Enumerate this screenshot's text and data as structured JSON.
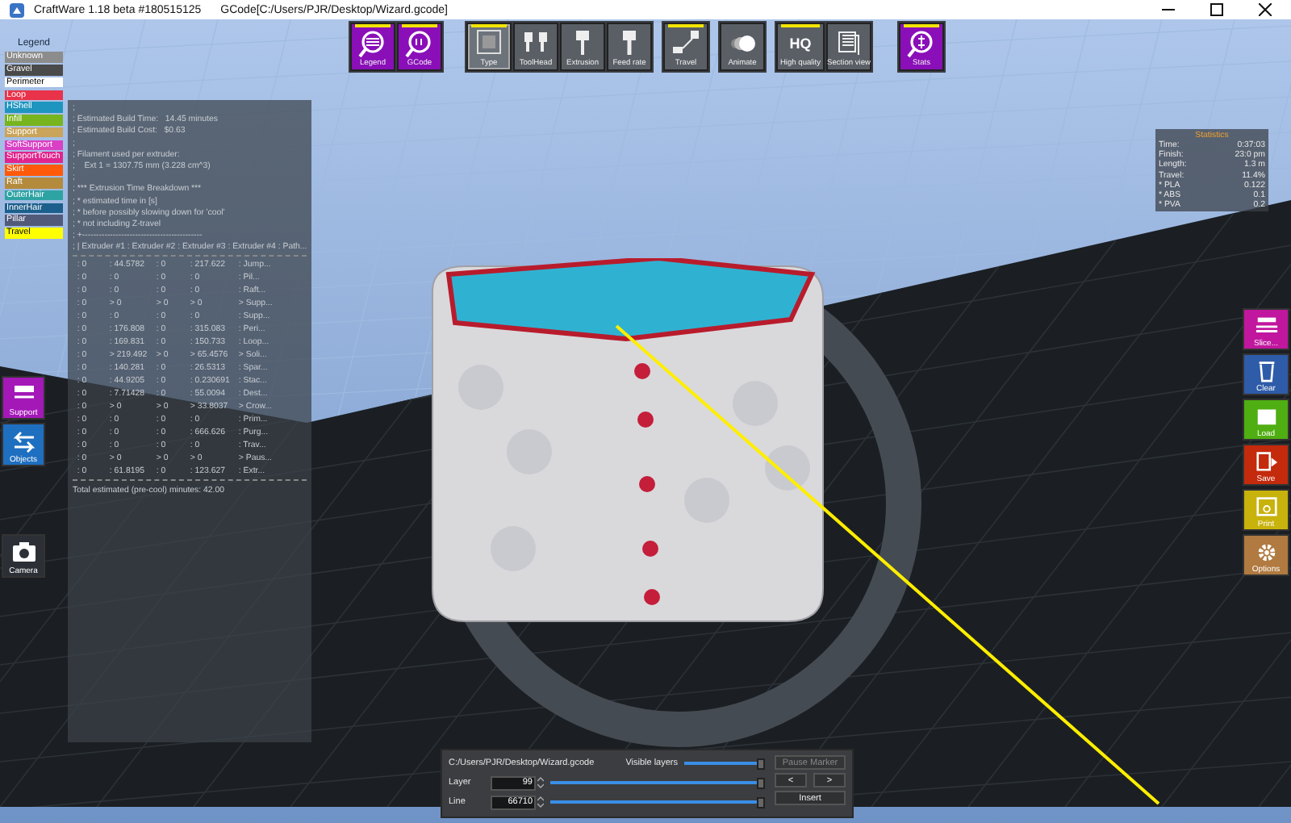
{
  "window": {
    "title": "CraftWare 1.18 beta #180515125",
    "document": "GCode[C:/Users/PJR/Desktop/Wizard.gcode]"
  },
  "legend": {
    "title": "Legend",
    "items": [
      {
        "label": "Unknown",
        "color": "#8c8c8c"
      },
      {
        "label": "Gravel",
        "color": "#4a4a4a"
      },
      {
        "label": "Perimeter",
        "color": "#ffffff"
      },
      {
        "label": "Loop",
        "color": "#e8334a"
      },
      {
        "label": "HShell",
        "color": "#1e95bf"
      },
      {
        "label": "Infill",
        "color": "#78b41e"
      },
      {
        "label": "Support",
        "color": "#c9a45a"
      },
      {
        "label": "SoftSupport",
        "color": "#d940c4"
      },
      {
        "label": "SupportTouch",
        "color": "#e0248e"
      },
      {
        "label": "Skirt",
        "color": "#ff5a0a"
      },
      {
        "label": "Raft",
        "color": "#b48a3c"
      },
      {
        "label": "OuterHair",
        "color": "#2ea3a3"
      },
      {
        "label": "InnerHair",
        "color": "#1d5f8c"
      },
      {
        "label": "Pillar",
        "color": "#525a7a"
      },
      {
        "label": "Travel",
        "color": "#ffff00"
      }
    ]
  },
  "toolbar": [
    [
      {
        "label": "Legend",
        "accent": true,
        "on": true,
        "selected": false
      },
      {
        "label": "GCode",
        "accent": true,
        "on": true,
        "selected": false
      }
    ],
    [
      {
        "label": "Type",
        "accent": false,
        "on": true,
        "selected": true
      },
      {
        "label": "ToolHead",
        "accent": false,
        "on": false,
        "selected": false
      },
      {
        "label": "Extrusion",
        "accent": false,
        "on": false,
        "selected": false
      },
      {
        "label": "Feed rate",
        "accent": false,
        "on": false,
        "selected": false
      }
    ],
    [
      {
        "label": "Travel",
        "accent": false,
        "on": true,
        "selected": false
      }
    ],
    [
      {
        "label": "Animate",
        "accent": false,
        "on": false,
        "selected": false
      }
    ],
    [
      {
        "label": "High quality",
        "badge": "HQ",
        "accent": false,
        "on": true,
        "selected": false
      },
      {
        "label": "Section view",
        "accent": false,
        "on": false,
        "selected": false
      }
    ],
    [
      {
        "label": "Stats",
        "accent": true,
        "on": true,
        "selected": false
      }
    ]
  ],
  "log": {
    "lines": [
      ";",
      "; Estimated Build Time:   14.45 minutes",
      "; Estimated Build Cost:   $0.63",
      ";",
      "; Filament used per extruder:",
      ";    Ext 1 = 1307.75 mm (3.228 cm^3)",
      ";",
      "; *** Extrusion Time Breakdown ***",
      "; * estimated time in [s]",
      "; * before possibly slowing down for 'cool'",
      "; * not including Z-travel",
      "; +-------------------------------------------",
      "; | Extruder #1 : Extruder #2 : Extruder #3 : Extruder #4 : Path..."
    ],
    "rows": [
      [
        "  : 0",
        "  : 44.5782",
        "  : 0",
        "  : 217.622",
        "  : Jump..."
      ],
      [
        "  : 0",
        "  : 0",
        "  : 0",
        "  : 0",
        "  : Pil..."
      ],
      [
        "  : 0",
        "  : 0",
        "  : 0",
        "  : 0",
        "  : Raft..."
      ],
      [
        "  : 0",
        "  > 0",
        "  > 0",
        "  > 0",
        "  > Supp..."
      ],
      [
        "  : 0",
        "  : 0",
        "  : 0",
        "  : 0",
        "  : Supp..."
      ],
      [
        "  : 0",
        "  : 176.808",
        "  : 0",
        "  : 315.083",
        "  : Peri..."
      ],
      [
        "  : 0",
        "  : 169.831",
        "  : 0",
        "  : 150.733",
        "  : Loop..."
      ],
      [
        "  : 0",
        "  > 219.492",
        "  > 0",
        "  > 65.4576",
        "  > Soli..."
      ],
      [
        "  : 0",
        "  : 140.281",
        "  : 0",
        "  : 26.5313",
        "  : Spar..."
      ],
      [
        "  : 0",
        "  : 44.9205",
        "  : 0",
        "  : 0.230691",
        "  : Stac..."
      ],
      [
        "  : 0",
        "  : 7.71428",
        "  : 0",
        "  : 55.0094",
        "  : Dest..."
      ],
      [
        "  : 0",
        "  > 0",
        "  > 0",
        "  > 33.8037",
        "  > Crow..."
      ],
      [
        "  : 0",
        "  : 0",
        "  : 0",
        "  : 0",
        "  : Prim..."
      ],
      [
        "  : 0",
        "  : 0",
        "  : 0",
        "  : 666.626",
        "  : Purg..."
      ],
      [
        "  : 0",
        "  : 0",
        "  : 0",
        "  : 0",
        "  : Trav..."
      ],
      [
        "  : 0",
        "  > 0",
        "  > 0",
        "  > 0",
        "  > Paus..."
      ],
      [
        "  : 0",
        "  : 61.8195",
        "  : 0",
        "  : 123.627",
        "  : Extr..."
      ]
    ],
    "total": "Total estimated (pre-cool) minutes: 42.00"
  },
  "stats": {
    "title": "Statistics",
    "rows": [
      {
        "label": "Time:",
        "value": "0:37:03"
      },
      {
        "label": "Finish:",
        "value": "23:0 pm"
      },
      {
        "label": "Length:",
        "value": "1.3 m"
      },
      {
        "label": "Travel:",
        "value": "11.4%"
      },
      {
        "label": "* PLA",
        "value": "0.122"
      },
      {
        "label": "* ABS",
        "value": "0.1"
      },
      {
        "label": "* PVA",
        "value": "0.2"
      }
    ]
  },
  "left_buttons": [
    {
      "label": "Support",
      "color": "#a418b8"
    },
    {
      "label": "Objects",
      "color": "#1f6fc0"
    }
  ],
  "camera_button": {
    "label": "Camera"
  },
  "right_buttons": [
    {
      "label": "Slice...",
      "color": "#c0179e"
    },
    {
      "label": "Clear",
      "color": "#2e5ca8"
    },
    {
      "label": "Load",
      "color": "#4fae12"
    },
    {
      "label": "Save",
      "color": "#c42a0c"
    },
    {
      "label": "Print",
      "color": "#c8b20c"
    },
    {
      "label": "Options",
      "color": "#b07a40"
    }
  ],
  "bottom_panel": {
    "file": "C:/Users/PJR/Desktop/Wizard.gcode",
    "visible_layers": {
      "label": "Visible layers",
      "level": 1
    },
    "layer": {
      "label": "Layer",
      "value": "99",
      "level": 1
    },
    "line": {
      "label": "Line",
      "value": "66710",
      "level": 1
    },
    "pause_marker": {
      "label": "Pause Marker",
      "disabled": true
    },
    "prev": {
      "label": "<"
    },
    "next": {
      "label": ">"
    },
    "insert": {
      "label": "Insert"
    }
  }
}
